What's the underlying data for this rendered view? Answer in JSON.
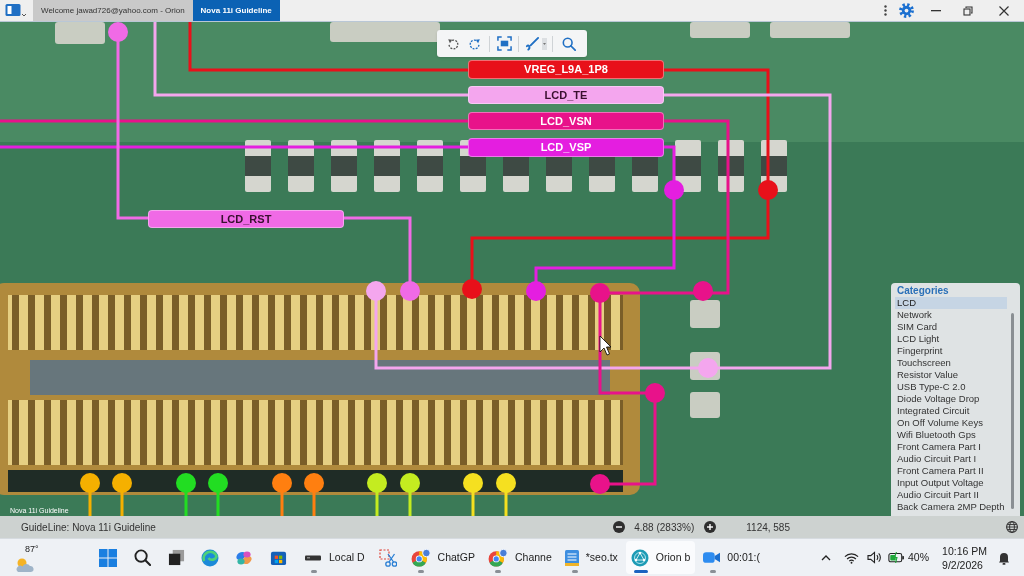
{
  "tabs": [
    {
      "label": "Welcome jawad726@yahoo.com - Orion",
      "selected": false
    },
    {
      "label": "Nova 11i Guideline",
      "selected": true
    }
  ],
  "nets": [
    {
      "label": "VREG_L9A_1P8",
      "color": "#e8101a"
    },
    {
      "label": "LCD_TE",
      "color": "#f4a6ee"
    },
    {
      "label": "LCD_VSN",
      "color": "#e8128a"
    },
    {
      "label": "LCD_VSP",
      "color": "#e41ee0"
    },
    {
      "label": "LCD_RST",
      "color": "#f06ae6"
    }
  ],
  "pins": [
    {
      "color": "#f5b000"
    },
    {
      "color": "#f5b000"
    },
    {
      "color": "#22dd22"
    },
    {
      "color": "#22dd22"
    },
    {
      "color": "#ff7f10"
    },
    {
      "color": "#ff7f10"
    },
    {
      "color": "#c4ec20"
    },
    {
      "color": "#c4ec20"
    },
    {
      "color": "#f5e020"
    },
    {
      "color": "#f5e020"
    }
  ],
  "canvas_caption": "Nova 11i Guideline",
  "categories": {
    "title": "Categories",
    "items": [
      {
        "label": "LCD",
        "selected": true
      },
      {
        "label": "Network",
        "selected": false
      },
      {
        "label": "SIM Card",
        "selected": false
      },
      {
        "label": "LCD Light",
        "selected": false
      },
      {
        "label": "Fingerprint",
        "selected": false
      },
      {
        "label": "Touchscreen",
        "selected": false
      },
      {
        "label": "Resistor Value",
        "selected": false
      },
      {
        "label": "USB Type-C 2.0",
        "selected": false
      },
      {
        "label": "Diode Voltage Drop",
        "selected": false
      },
      {
        "label": "Integrated Circuit",
        "selected": false
      },
      {
        "label": "On Off Volume Keys",
        "selected": false
      },
      {
        "label": "Wifi Bluetooth Gps",
        "selected": false
      },
      {
        "label": "Front Camera Part I",
        "selected": false
      },
      {
        "label": "Audio Circuit Part I",
        "selected": false
      },
      {
        "label": "Front Camera Part II",
        "selected": false
      },
      {
        "label": "Input Output Voltage",
        "selected": false
      },
      {
        "label": "Audio Circuit Part II",
        "selected": false
      },
      {
        "label": "Back Camera 2MP Depth",
        "selected": false
      }
    ]
  },
  "status_bar": {
    "guideline": "GuideLine: Nova 11i Guideline",
    "zoom": "4.88 (2833%)",
    "cursor_position": "1124, 585"
  },
  "taskbar": {
    "weather": "87°",
    "apps": [
      {
        "label": "Local D",
        "selected": false
      },
      {
        "label": "ChatGP",
        "selected": false
      },
      {
        "label": "Channe",
        "selected": false
      },
      {
        "label": "*seo.tx",
        "selected": false
      },
      {
        "label": "Orion b",
        "selected": true
      },
      {
        "label": "00:01:(",
        "selected": false
      }
    ],
    "battery": "40%",
    "time": "10:16 PM",
    "date": "9/2/2026"
  }
}
